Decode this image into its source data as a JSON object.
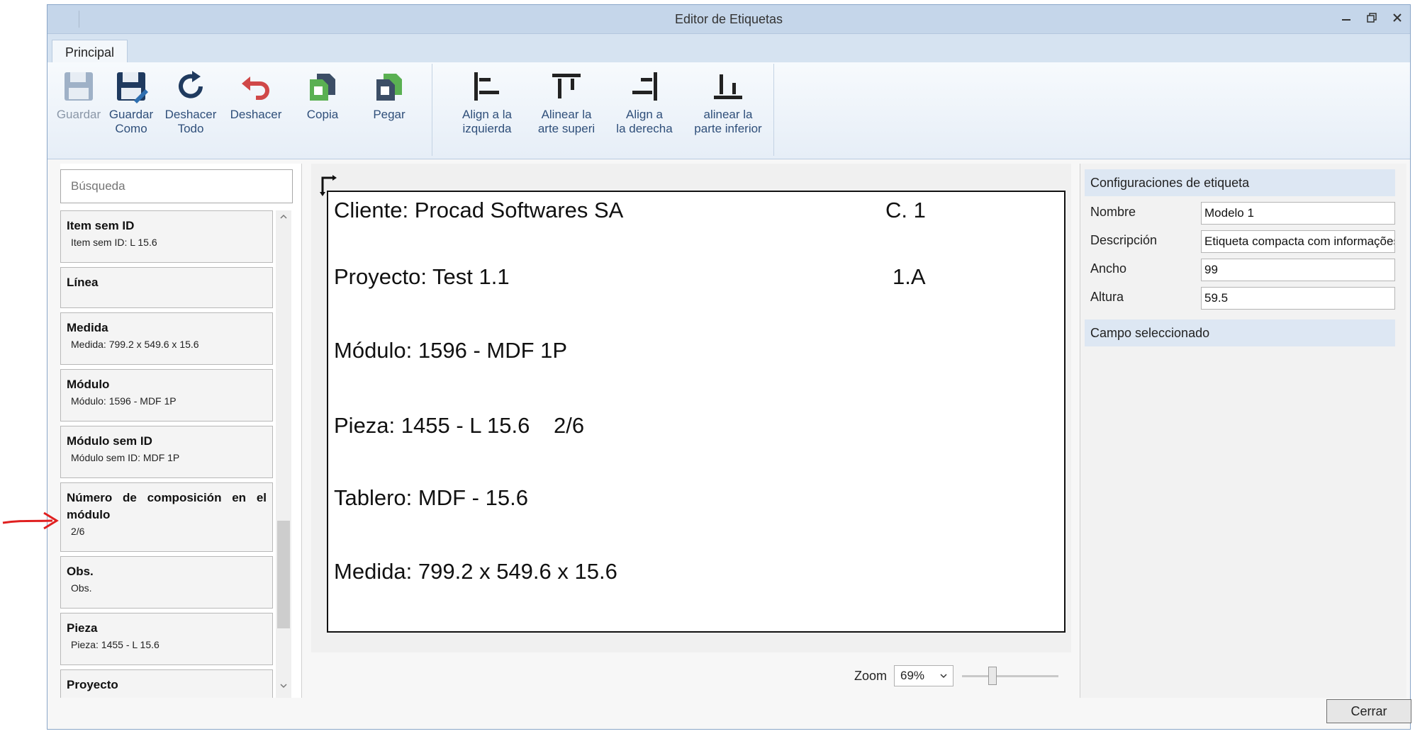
{
  "window": {
    "title": "Editor de Etiquetas"
  },
  "ribbon": {
    "tab": "Principal",
    "buttons": {
      "save": "Guardar",
      "save_as_l1": "Guardar",
      "save_as_l2": "Como",
      "undo_all_l1": "Deshacer",
      "undo_all_l2": "Todo",
      "undo": "Deshacer",
      "copy": "Copia",
      "paste": "Pegar",
      "align_left_l1": "Align a la",
      "align_left_l2": "izquierda",
      "align_top_l1": "Alinear la",
      "align_top_l2": "arte superi",
      "align_right_l1": "Align a",
      "align_right_l2": "la derecha",
      "align_bottom_l1": "alinear la",
      "align_bottom_l2": "parte inferior"
    }
  },
  "fields_panel": {
    "search_placeholder": "Búsqueda",
    "items": [
      {
        "title": "Item sem ID",
        "sub": "Item sem ID: L 15.6"
      },
      {
        "title": "Línea",
        "sub": ""
      },
      {
        "title": "Medida",
        "sub": "Medida: 799.2 x 549.6 x 15.6"
      },
      {
        "title": "Módulo",
        "sub": "Módulo: 1596 - MDF 1P"
      },
      {
        "title": "Módulo sem ID",
        "sub": "Módulo sem ID: MDF 1P"
      },
      {
        "title": "Número de composición en el módulo",
        "sub": "2/6"
      },
      {
        "title": "Obs.",
        "sub": "Obs."
      },
      {
        "title": "Pieza",
        "sub": "Pieza: 1455 - L 15.6"
      },
      {
        "title": "Proyecto",
        "sub": ""
      }
    ]
  },
  "label": {
    "cliente": "Cliente: Procad Softwares SA",
    "c1": "C. 1",
    "proyecto": "Proyecto: Test 1.1",
    "a1": "1.A",
    "modulo": "Módulo: 1596 - MDF 1P",
    "pieza": "Pieza: 1455 - L 15.6",
    "pieza_num": "2/6",
    "tablero": "Tablero: MDF - 15.6",
    "medida": "Medida: 799.2 x 549.6 x 15.6"
  },
  "zoom": {
    "label": "Zoom",
    "value": "69%",
    "slider_fraction": 0.3
  },
  "properties": {
    "section_title": "Configuraciones de etiqueta",
    "rows": [
      {
        "label": "Nombre",
        "value": "Modelo 1"
      },
      {
        "label": "Descripción",
        "value": "Etiqueta compacta com informações"
      },
      {
        "label": "Ancho",
        "value": "99"
      },
      {
        "label": "Altura",
        "value": "59.5"
      }
    ],
    "selected_title": "Campo seleccionado"
  },
  "footer": {
    "close": "Cerrar"
  },
  "colors": {
    "accent": "#2f6fb0",
    "annotation_arrow": "#e02020"
  }
}
